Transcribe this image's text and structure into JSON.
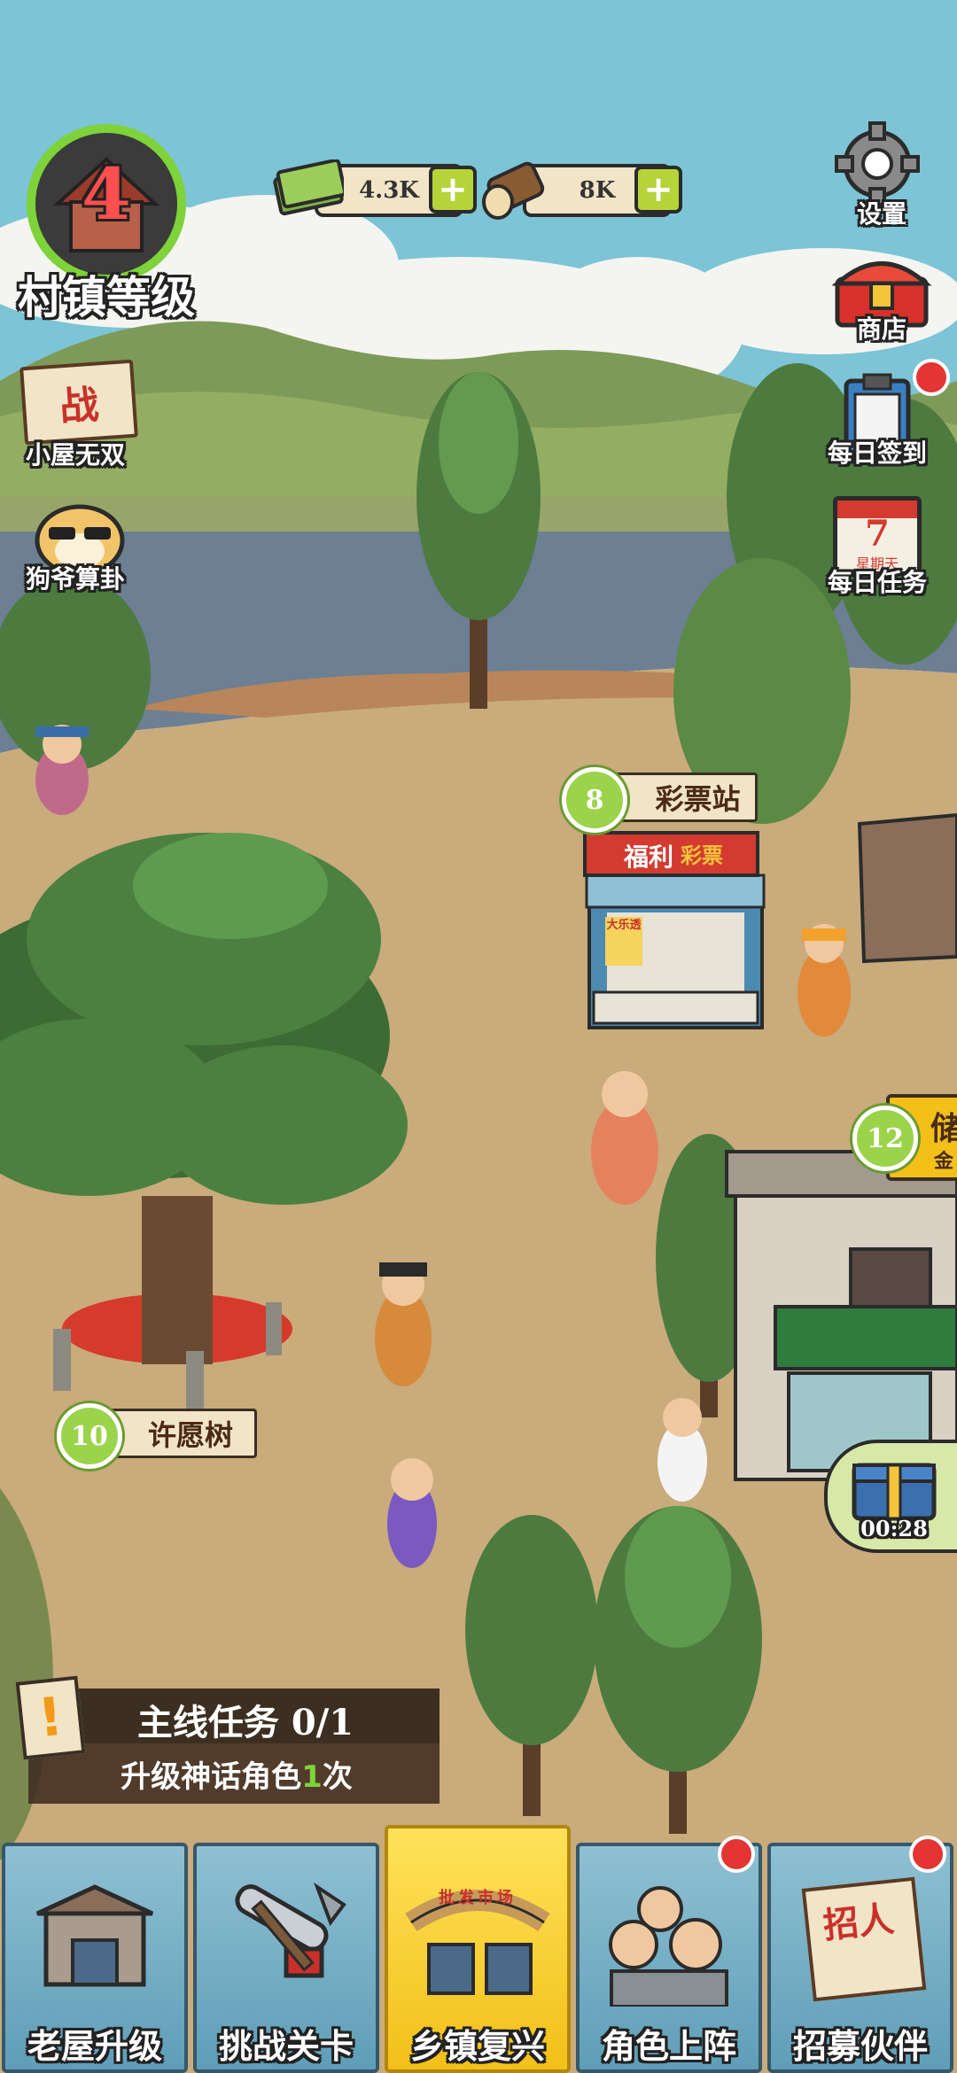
{
  "hud": {
    "town_level": "4",
    "town_level_label": "村镇等级",
    "cash_amount": "4.3K",
    "wood_amount": "8K",
    "settings_label": "设置",
    "shop_label": "商店",
    "daily_checkin_label": "每日签到",
    "daily_task_label": "每日任务",
    "calendar_day": "7",
    "calendar_weekday": "星期天"
  },
  "left_menu": {
    "battle_sign": "战",
    "hut_label": "小屋无双",
    "fortune_label": "狗爷算卦"
  },
  "places": [
    {
      "level": "8",
      "name": "彩票站"
    },
    {
      "level": "10",
      "name": "许愿树"
    },
    {
      "level": "12",
      "name": "储",
      "sub": "金"
    }
  ],
  "lottery_sign": {
    "left": "福利",
    "right": "彩票",
    "poster": "大乐透"
  },
  "reward_box": {
    "timer": "00:28"
  },
  "task": {
    "title": "主线任务 0/1",
    "desc_before": "升级神话角色",
    "desc_count": "1",
    "desc_after": "次"
  },
  "market_sign": "批发市场",
  "recruit_sign": "招人",
  "bottom_nav": [
    {
      "label": "老屋升级",
      "badge": false
    },
    {
      "label": "挑战关卡",
      "badge": false
    },
    {
      "label": "乡镇复兴",
      "badge": false,
      "active": true
    },
    {
      "label": "角色上阵",
      "badge": true
    },
    {
      "label": "招募伙伴",
      "badge": true
    }
  ],
  "colors": {
    "sky": "#7cc4d6",
    "ground": "#c9ab7c",
    "water": "#6c7f93",
    "accent_green": "#9bd34b",
    "nav_active": "#f2c019",
    "badge_red": "#e43434"
  }
}
